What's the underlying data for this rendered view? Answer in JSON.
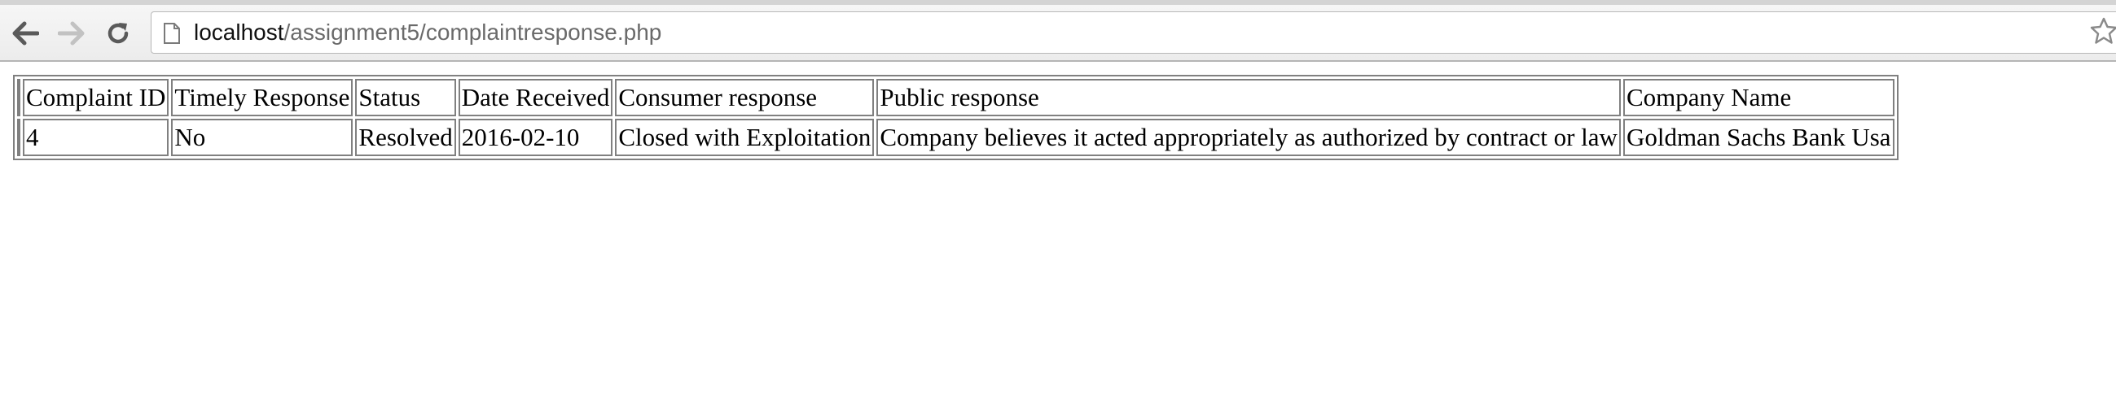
{
  "browser": {
    "url_host": "localhost",
    "url_path": "/assignment5/complaintresponse.php"
  },
  "table": {
    "headers": [
      "Complaint ID",
      "Timely Response",
      "Status",
      "Date Received",
      "Consumer response",
      "Public response",
      "Company Name"
    ],
    "rows": [
      [
        "4",
        "No",
        "Resolved",
        "2016-02-10",
        "Closed with Exploitation",
        "Company believes it acted appropriately as authorized by contract or law",
        "Goldman Sachs Bank Usa"
      ]
    ]
  }
}
